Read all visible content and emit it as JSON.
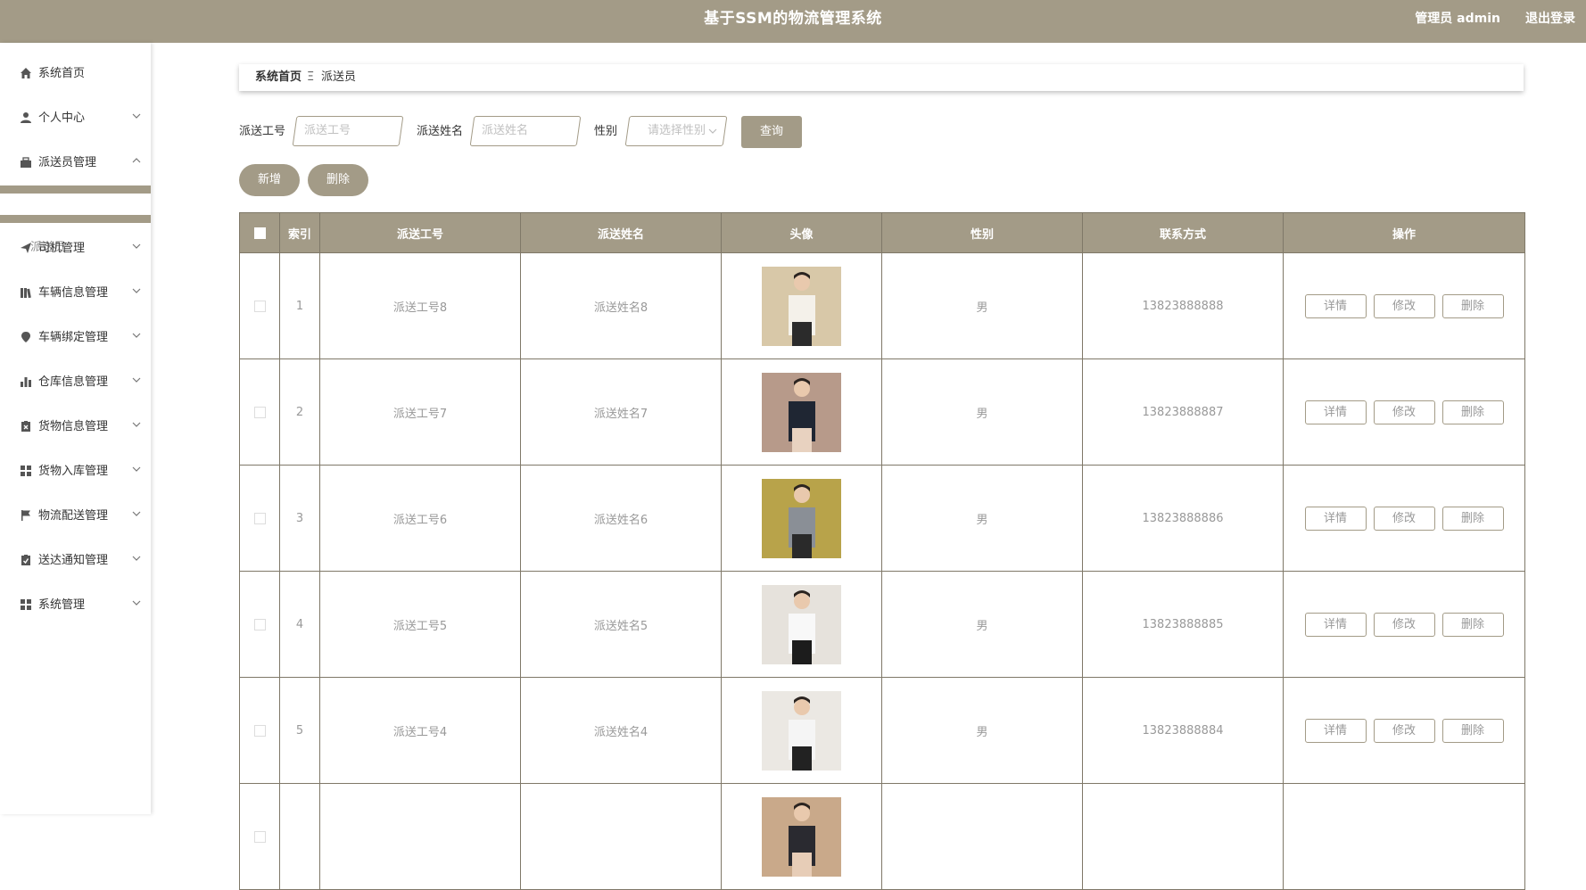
{
  "header": {
    "title": "基于SSM的物流管理系统",
    "user_label": "管理员 admin",
    "logout_label": "退出登录"
  },
  "sidebar": {
    "items": [
      {
        "label": "系统首页",
        "icon": "home-icon",
        "has_arrow": false
      },
      {
        "label": "个人中心",
        "icon": "user-icon",
        "has_arrow": true,
        "expanded": false
      },
      {
        "label": "派送员管理",
        "icon": "briefcase-icon",
        "has_arrow": true,
        "expanded": true
      },
      {
        "label": "司机管理",
        "icon": "send-icon",
        "has_arrow": true,
        "expanded": false
      },
      {
        "label": "车辆信息管理",
        "icon": "book-icon",
        "has_arrow": true,
        "expanded": false
      },
      {
        "label": "车辆绑定管理",
        "icon": "map-pin-icon",
        "has_arrow": true,
        "expanded": false
      },
      {
        "label": "仓库信息管理",
        "icon": "bar-chart-icon",
        "has_arrow": true,
        "expanded": false
      },
      {
        "label": "货物信息管理",
        "icon": "clipboard-x-icon",
        "has_arrow": true,
        "expanded": false
      },
      {
        "label": "货物入库管理",
        "icon": "grid-icon",
        "has_arrow": true,
        "expanded": false
      },
      {
        "label": "物流配送管理",
        "icon": "flag-icon",
        "has_arrow": true,
        "expanded": false
      },
      {
        "label": "送达通知管理",
        "icon": "clipboard-check-icon",
        "has_arrow": true,
        "expanded": false
      },
      {
        "label": "系统管理",
        "icon": "grid-icon",
        "has_arrow": true,
        "expanded": false
      }
    ],
    "submenu": {
      "label": "派送员"
    }
  },
  "breadcrumb": {
    "home": "系统首页",
    "separator": "Ξ",
    "current": "派送员"
  },
  "search": {
    "worker_id_label": "派送工号",
    "worker_id_placeholder": "派送工号",
    "worker_name_label": "派送姓名",
    "worker_name_placeholder": "派送姓名",
    "gender_label": "性别",
    "gender_placeholder": "请选择性别",
    "query_button": "查询"
  },
  "actions": {
    "add_button": "新增",
    "delete_button": "删除"
  },
  "table": {
    "columns": [
      "索引",
      "派送工号",
      "派送姓名",
      "头像",
      "性别",
      "联系方式",
      "操作"
    ],
    "rows": [
      {
        "index": "1",
        "worker_id": "派送工号8",
        "worker_name": "派送姓名8",
        "gender": "男",
        "phone": "13823888888"
      },
      {
        "index": "2",
        "worker_id": "派送工号7",
        "worker_name": "派送姓名7",
        "gender": "男",
        "phone": "13823888887"
      },
      {
        "index": "3",
        "worker_id": "派送工号6",
        "worker_name": "派送姓名6",
        "gender": "男",
        "phone": "13823888886"
      },
      {
        "index": "4",
        "worker_id": "派送工号5",
        "worker_name": "派送姓名5",
        "gender": "男",
        "phone": "13823888885"
      },
      {
        "index": "5",
        "worker_id": "派送工号4",
        "worker_name": "派送姓名4",
        "gender": "男",
        "phone": "13823888884"
      },
      {
        "index": "",
        "worker_id": "",
        "worker_name": "",
        "gender": "",
        "phone": ""
      }
    ],
    "row_actions": {
      "detail": "详情",
      "edit": "修改",
      "delete": "删除"
    }
  },
  "colors": {
    "accent": "#a39b87",
    "border": "#7f7868"
  }
}
